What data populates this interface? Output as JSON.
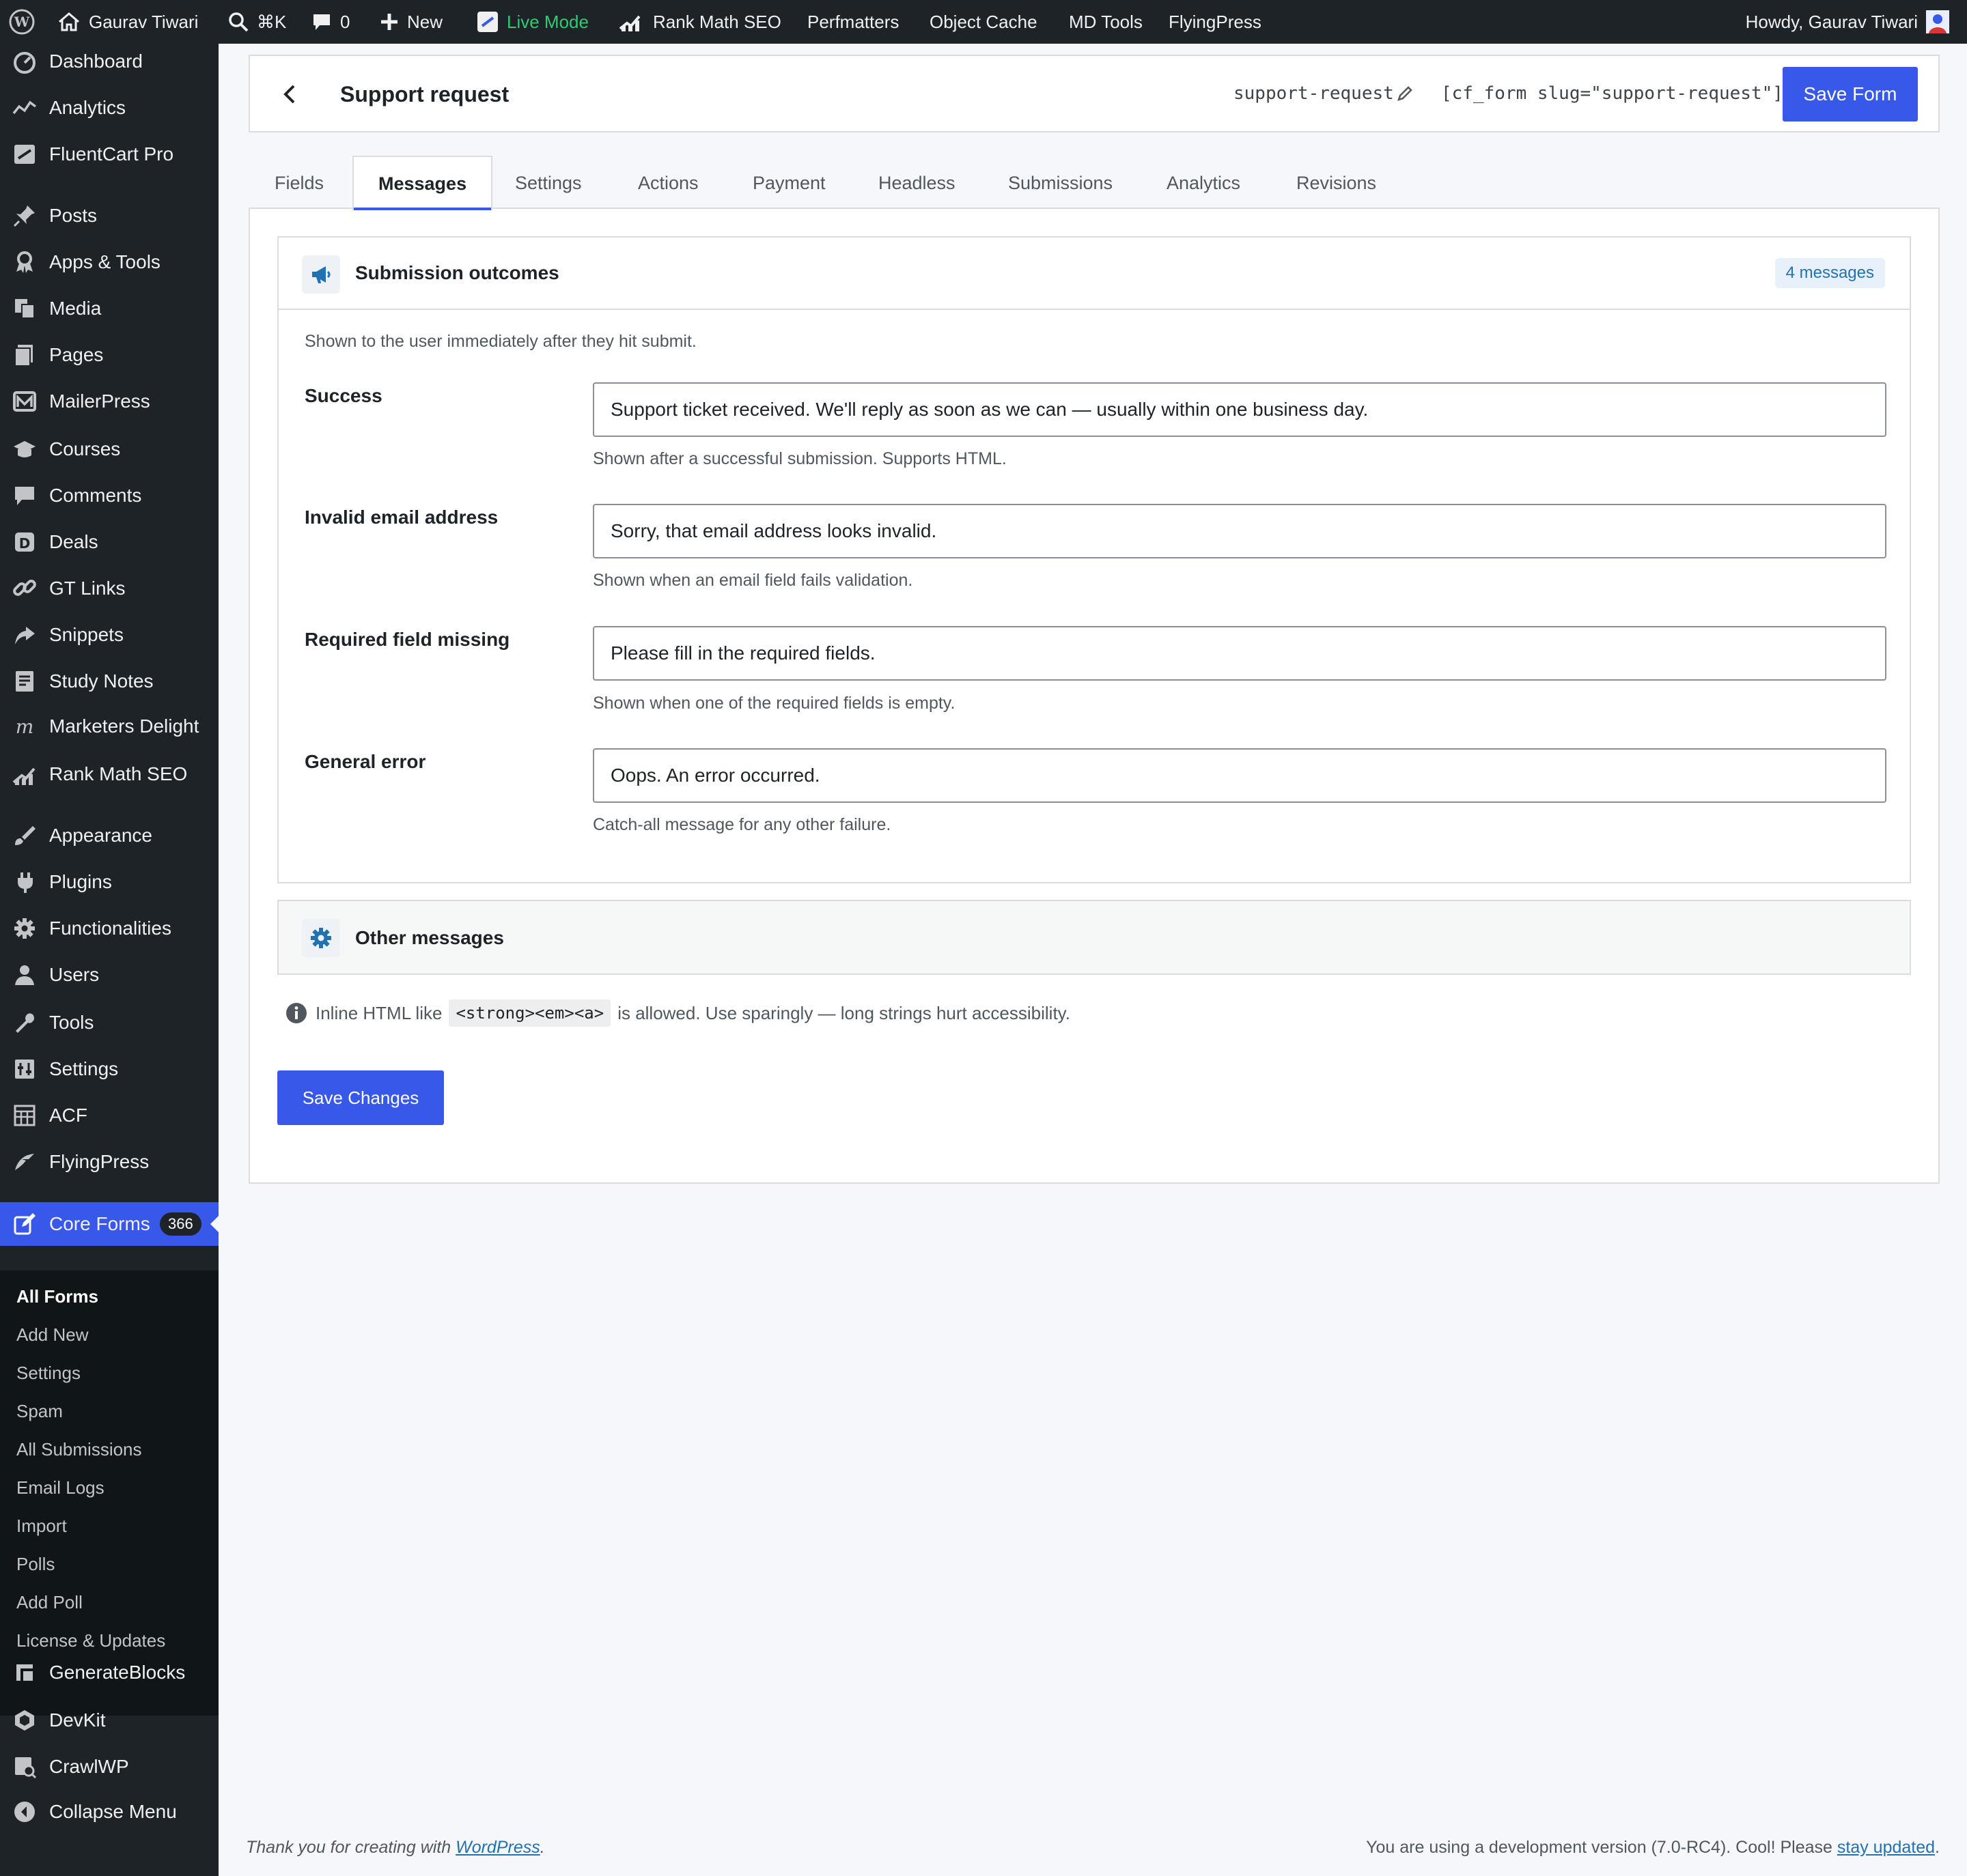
{
  "adminbar": {
    "site_name": "Gaurav Tiwari",
    "shortcut": "⌘K",
    "comments_count": "0",
    "new_label": "New",
    "live_mode": "Live Mode",
    "items": [
      "Rank Math SEO",
      "Perfmatters",
      "Object Cache",
      "MD Tools",
      "FlyingPress"
    ],
    "howdy": "Howdy, Gaurav Tiwari"
  },
  "sidebar": {
    "items": [
      {
        "label": "Dashboard",
        "icon": "dashboard-icon"
      },
      {
        "label": "Analytics",
        "icon": "analytics-icon"
      },
      {
        "label": "FluentCart Pro",
        "icon": "fluentcart-icon"
      },
      {
        "label": "Posts",
        "icon": "pin-icon"
      },
      {
        "label": "Apps & Tools",
        "icon": "award-icon"
      },
      {
        "label": "Media",
        "icon": "media-icon"
      },
      {
        "label": "Pages",
        "icon": "pages-icon"
      },
      {
        "label": "MailerPress",
        "icon": "mail-icon"
      },
      {
        "label": "Courses",
        "icon": "courses-icon"
      },
      {
        "label": "Comments",
        "icon": "comment-icon"
      },
      {
        "label": "Deals",
        "icon": "deals-icon"
      },
      {
        "label": "GT Links",
        "icon": "link-icon"
      },
      {
        "label": "Snippets",
        "icon": "snippets-icon"
      },
      {
        "label": "Study Notes",
        "icon": "notes-icon"
      },
      {
        "label": "Marketers Delight",
        "icon": "md-icon"
      },
      {
        "label": "Rank Math SEO",
        "icon": "rankmath-icon"
      },
      {
        "label": "Appearance",
        "icon": "brush-icon"
      },
      {
        "label": "Plugins",
        "icon": "plugin-icon"
      },
      {
        "label": "Functionalities",
        "icon": "gear-icon"
      },
      {
        "label": "Users",
        "icon": "user-icon"
      },
      {
        "label": "Tools",
        "icon": "wrench-icon"
      },
      {
        "label": "Settings",
        "icon": "settings-icon"
      },
      {
        "label": "ACF",
        "icon": "acf-icon"
      },
      {
        "label": "FlyingPress",
        "icon": "flyingpress-icon"
      },
      {
        "label": "Core Forms",
        "icon": "edit-icon",
        "badge": "366"
      },
      {
        "label": "GenerateBlocks",
        "icon": "generateblocks-icon"
      },
      {
        "label": "DevKit",
        "icon": "devkit-icon"
      },
      {
        "label": "CrawlWP",
        "icon": "crawlwp-icon"
      },
      {
        "label": "Collapse Menu",
        "icon": "collapse-icon"
      }
    ],
    "submenu": [
      "All Forms",
      "Add New",
      "Settings",
      "Spam",
      "All Submissions",
      "Email Logs",
      "Import",
      "Polls",
      "Add Poll",
      "License & Updates"
    ]
  },
  "header": {
    "title": "Support request",
    "slug": "support-request",
    "shortcode": "[cf_form slug=\"support-request\"]",
    "save_label": "Save Form"
  },
  "tabs": [
    "Fields",
    "Messages",
    "Settings",
    "Actions",
    "Payment",
    "Headless",
    "Submissions",
    "Analytics",
    "Revisions"
  ],
  "outcomes": {
    "title": "Submission outcomes",
    "count": "4 messages",
    "intro": "Shown to the user immediately after they hit submit.",
    "rows": [
      {
        "label": "Success",
        "value": "Support ticket received. We'll reply as soon as we can — usually within one business day.",
        "help": "Shown after a successful submission. Supports HTML."
      },
      {
        "label": "Invalid email address",
        "value": "Sorry, that email address looks invalid.",
        "help": "Shown when an email field fails validation."
      },
      {
        "label": "Required field missing",
        "value": "Please fill in the required fields.",
        "help": "Shown when one of the required fields is empty."
      },
      {
        "label": "General error",
        "value": "Oops. An error occurred.",
        "help": "Catch-all message for any other failure."
      }
    ]
  },
  "other": {
    "title": "Other messages"
  },
  "note": {
    "before": "Inline HTML like",
    "code": "<strong><em><a>",
    "after": "is allowed. Use sparingly — long strings hurt accessibility."
  },
  "save_changes": "Save Changes",
  "footer": {
    "left_text": "Thank you for creating with ",
    "left_link": "WordPress",
    "left_end": ".",
    "right_text": "You are using a development version (7.0-RC4). Cool! Please ",
    "right_link": "stay updated",
    "right_end": "."
  },
  "colors": {
    "accent": "#3858e9",
    "sidebar": "#1d2327",
    "live": "#2ecc71"
  }
}
